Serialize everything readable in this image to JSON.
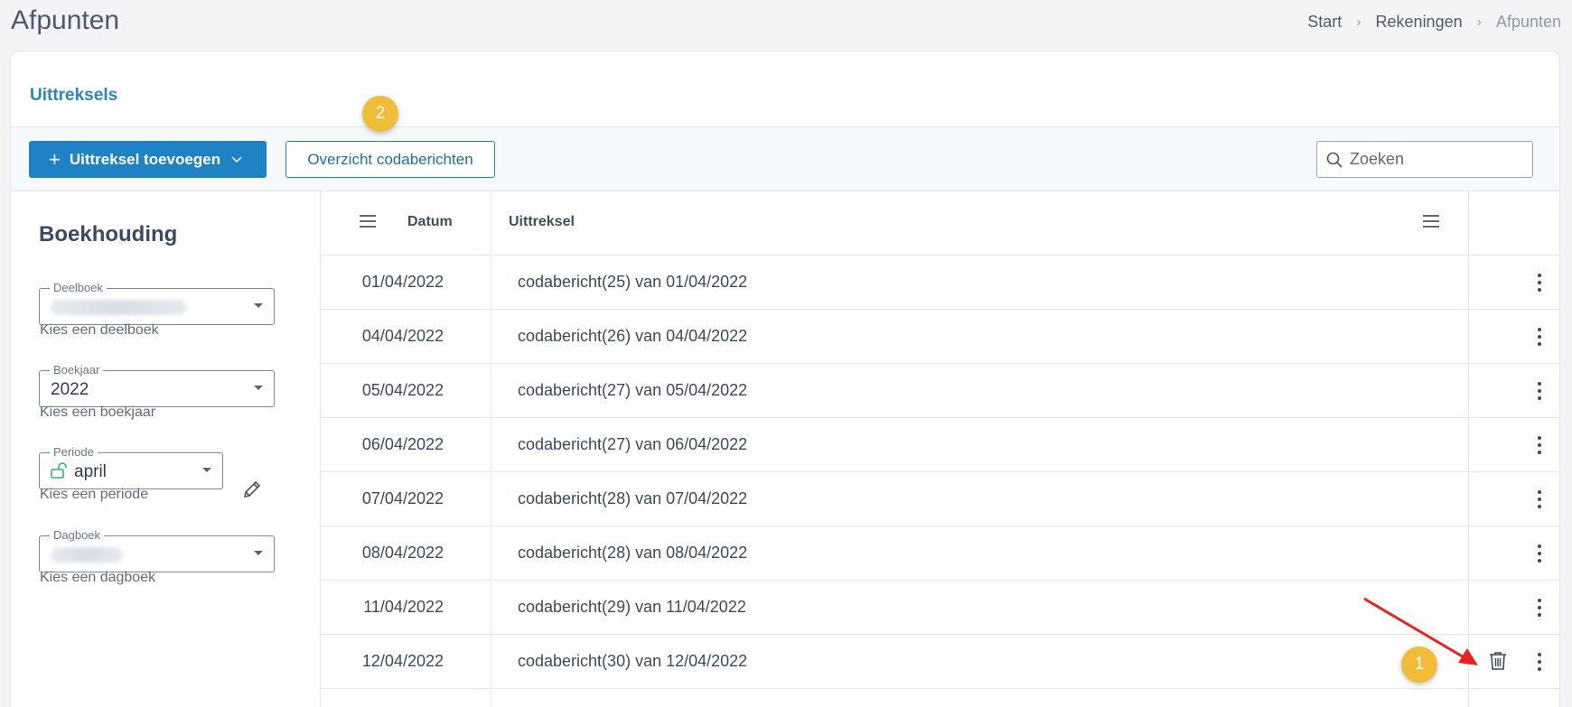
{
  "page": {
    "title": "Afpunten"
  },
  "breadcrumb": {
    "items": [
      "Start",
      "Rekeningen",
      "Afpunten"
    ]
  },
  "card": {
    "tab_title": "Uittreksels"
  },
  "toolbar": {
    "add_button_label": "Uittreksel toevoegen",
    "overview_button_label": "Overzicht codaberichten",
    "search_placeholder": "Zoeken"
  },
  "badges": {
    "one": "1",
    "two": "2"
  },
  "side": {
    "title": "Boekhouding",
    "deelboek": {
      "legend": "Deelboek",
      "helper": "Kies een deelboek"
    },
    "boekjaar": {
      "legend": "Boekjaar",
      "value": "2022",
      "helper": "Kies een boekjaar"
    },
    "periode": {
      "legend": "Periode",
      "value": "april",
      "helper": "Kies een periode"
    },
    "dagboek": {
      "legend": "Dagboek",
      "helper": "Kies een dagboek"
    }
  },
  "table": {
    "columns": {
      "datum": "Datum",
      "uittreksel": "Uittreksel"
    },
    "rows": [
      {
        "datum": "01/04/2022",
        "uittreksel": "codabericht(25) van 01/04/2022"
      },
      {
        "datum": "04/04/2022",
        "uittreksel": "codabericht(26) van 04/04/2022"
      },
      {
        "datum": "05/04/2022",
        "uittreksel": "codabericht(27) van 05/04/2022"
      },
      {
        "datum": "06/04/2022",
        "uittreksel": "codabericht(27) van 06/04/2022"
      },
      {
        "datum": "07/04/2022",
        "uittreksel": "codabericht(28) van 07/04/2022"
      },
      {
        "datum": "08/04/2022",
        "uittreksel": "codabericht(28) van 08/04/2022"
      },
      {
        "datum": "11/04/2022",
        "uittreksel": "codabericht(29) van 11/04/2022"
      },
      {
        "datum": "12/04/2022",
        "uittreksel": "codabericht(30) van 12/04/2022"
      }
    ]
  },
  "colors": {
    "primary": "#1e82c4",
    "badge": "#f0bc3a",
    "arrow": "#e8231f",
    "lock_green": "#2bb673"
  }
}
